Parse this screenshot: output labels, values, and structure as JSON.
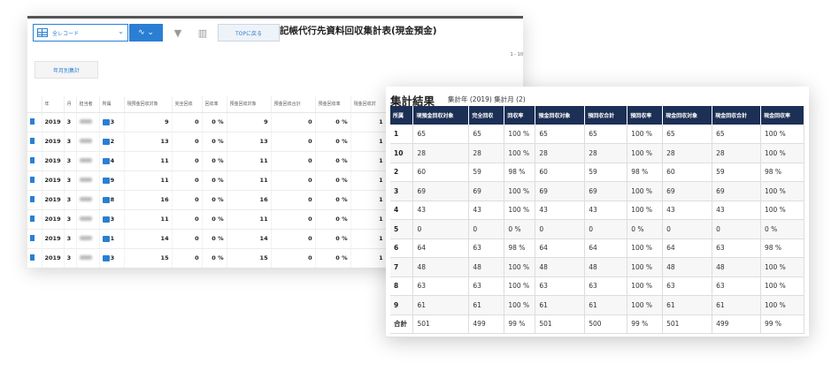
{
  "back": {
    "select_value": "全レコード",
    "top_button": "TOPに戻る",
    "title": "記帳代行先資料回収集計表(現金預金)",
    "pager": "1 - 10",
    "month_button": "年月別集計",
    "columns": [
      "年",
      "月",
      "担当者",
      "所属",
      "現預金回収対象",
      "完全回収",
      "回収率",
      "預金回収対象",
      "預金回収合計",
      "預金回収率",
      "現金回収対"
    ],
    "rows": [
      {
        "year": "2019",
        "month": "3",
        "dept": "3",
        "target": "9",
        "full": "0",
        "rate": "0 %",
        "dep_target": "9",
        "dep_total": "0",
        "dep_rate": "0 %",
        "cash": "1"
      },
      {
        "year": "2019",
        "month": "3",
        "dept": "2",
        "target": "13",
        "full": "0",
        "rate": "0 %",
        "dep_target": "13",
        "dep_total": "0",
        "dep_rate": "0 %",
        "cash": "1"
      },
      {
        "year": "2019",
        "month": "3",
        "dept": "4",
        "target": "11",
        "full": "0",
        "rate": "0 %",
        "dep_target": "11",
        "dep_total": "0",
        "dep_rate": "0 %",
        "cash": "1"
      },
      {
        "year": "2019",
        "month": "3",
        "dept": "9",
        "target": "11",
        "full": "0",
        "rate": "0 %",
        "dep_target": "11",
        "dep_total": "0",
        "dep_rate": "0 %",
        "cash": "1"
      },
      {
        "year": "2019",
        "month": "3",
        "dept": "8",
        "target": "16",
        "full": "0",
        "rate": "0 %",
        "dep_target": "16",
        "dep_total": "0",
        "dep_rate": "0 %",
        "cash": "1"
      },
      {
        "year": "2019",
        "month": "3",
        "dept": "3",
        "target": "11",
        "full": "0",
        "rate": "0 %",
        "dep_target": "11",
        "dep_total": "0",
        "dep_rate": "0 %",
        "cash": "1"
      },
      {
        "year": "2019",
        "month": "3",
        "dept": "1",
        "target": "14",
        "full": "0",
        "rate": "0 %",
        "dep_target": "14",
        "dep_total": "0",
        "dep_rate": "0 %",
        "cash": "1"
      },
      {
        "year": "2019",
        "month": "3",
        "dept": "3",
        "target": "15",
        "full": "0",
        "rate": "0 %",
        "dep_target": "15",
        "dep_total": "0",
        "dep_rate": "0 %",
        "cash": "1"
      }
    ]
  },
  "front": {
    "title": "集計結果",
    "subtitle": "集計年 (2019) 集計月 (2)",
    "columns": [
      "所属",
      "現預金回収対象",
      "完全回収",
      "回収率",
      "預金回収対象",
      "預回収合計",
      "預回収率",
      "現金回収対象",
      "現金回収合計",
      "現金回収率"
    ],
    "rows": [
      [
        "1",
        "65",
        "65",
        "100 %",
        "65",
        "65",
        "100 %",
        "65",
        "65",
        "100 %"
      ],
      [
        "10",
        "28",
        "28",
        "100 %",
        "28",
        "28",
        "100 %",
        "28",
        "28",
        "100 %"
      ],
      [
        "2",
        "60",
        "59",
        "98 %",
        "60",
        "59",
        "98 %",
        "60",
        "59",
        "98 %"
      ],
      [
        "3",
        "69",
        "69",
        "100 %",
        "69",
        "69",
        "100 %",
        "69",
        "69",
        "100 %"
      ],
      [
        "4",
        "43",
        "43",
        "100 %",
        "43",
        "43",
        "100 %",
        "43",
        "43",
        "100 %"
      ],
      [
        "5",
        "0",
        "0",
        "0 %",
        "0",
        "0",
        "0 %",
        "0",
        "0",
        "0 %"
      ],
      [
        "6",
        "64",
        "63",
        "98 %",
        "64",
        "64",
        "100 %",
        "64",
        "63",
        "98 %"
      ],
      [
        "7",
        "48",
        "48",
        "100 %",
        "48",
        "48",
        "100 %",
        "48",
        "48",
        "100 %"
      ],
      [
        "8",
        "63",
        "63",
        "100 %",
        "63",
        "63",
        "100 %",
        "63",
        "63",
        "100 %"
      ],
      [
        "9",
        "61",
        "61",
        "100 %",
        "61",
        "61",
        "100 %",
        "61",
        "61",
        "100 %"
      ],
      [
        "合計",
        "501",
        "499",
        "99 %",
        "501",
        "500",
        "99 %",
        "501",
        "499",
        "99 %"
      ]
    ]
  }
}
